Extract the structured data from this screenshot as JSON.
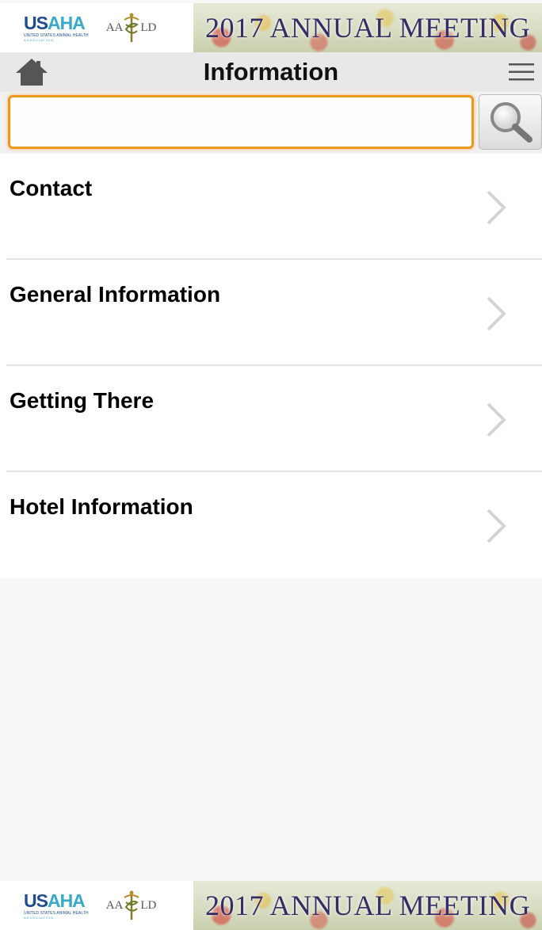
{
  "banner": {
    "usaha_text_1": "US",
    "usaha_text_2": "AHA",
    "usaha_subtitle": "UNITED STATES ANIMAL HEALTH",
    "usaha_dots": "ASSOCIATION",
    "aavld_left": "AA",
    "aavld_right": "LD",
    "title": "2017 ANNUAL MEETING"
  },
  "header": {
    "title": "Information",
    "home_icon": "home-icon",
    "menu_icon": "hamburger-menu-icon"
  },
  "search": {
    "value": "",
    "placeholder": "",
    "button_icon": "search-icon",
    "accent_color": "#f0961e"
  },
  "list": {
    "items": [
      {
        "label": "Contact"
      },
      {
        "label": "General Information"
      },
      {
        "label": "Getting There"
      },
      {
        "label": "Hotel Information"
      }
    ]
  }
}
